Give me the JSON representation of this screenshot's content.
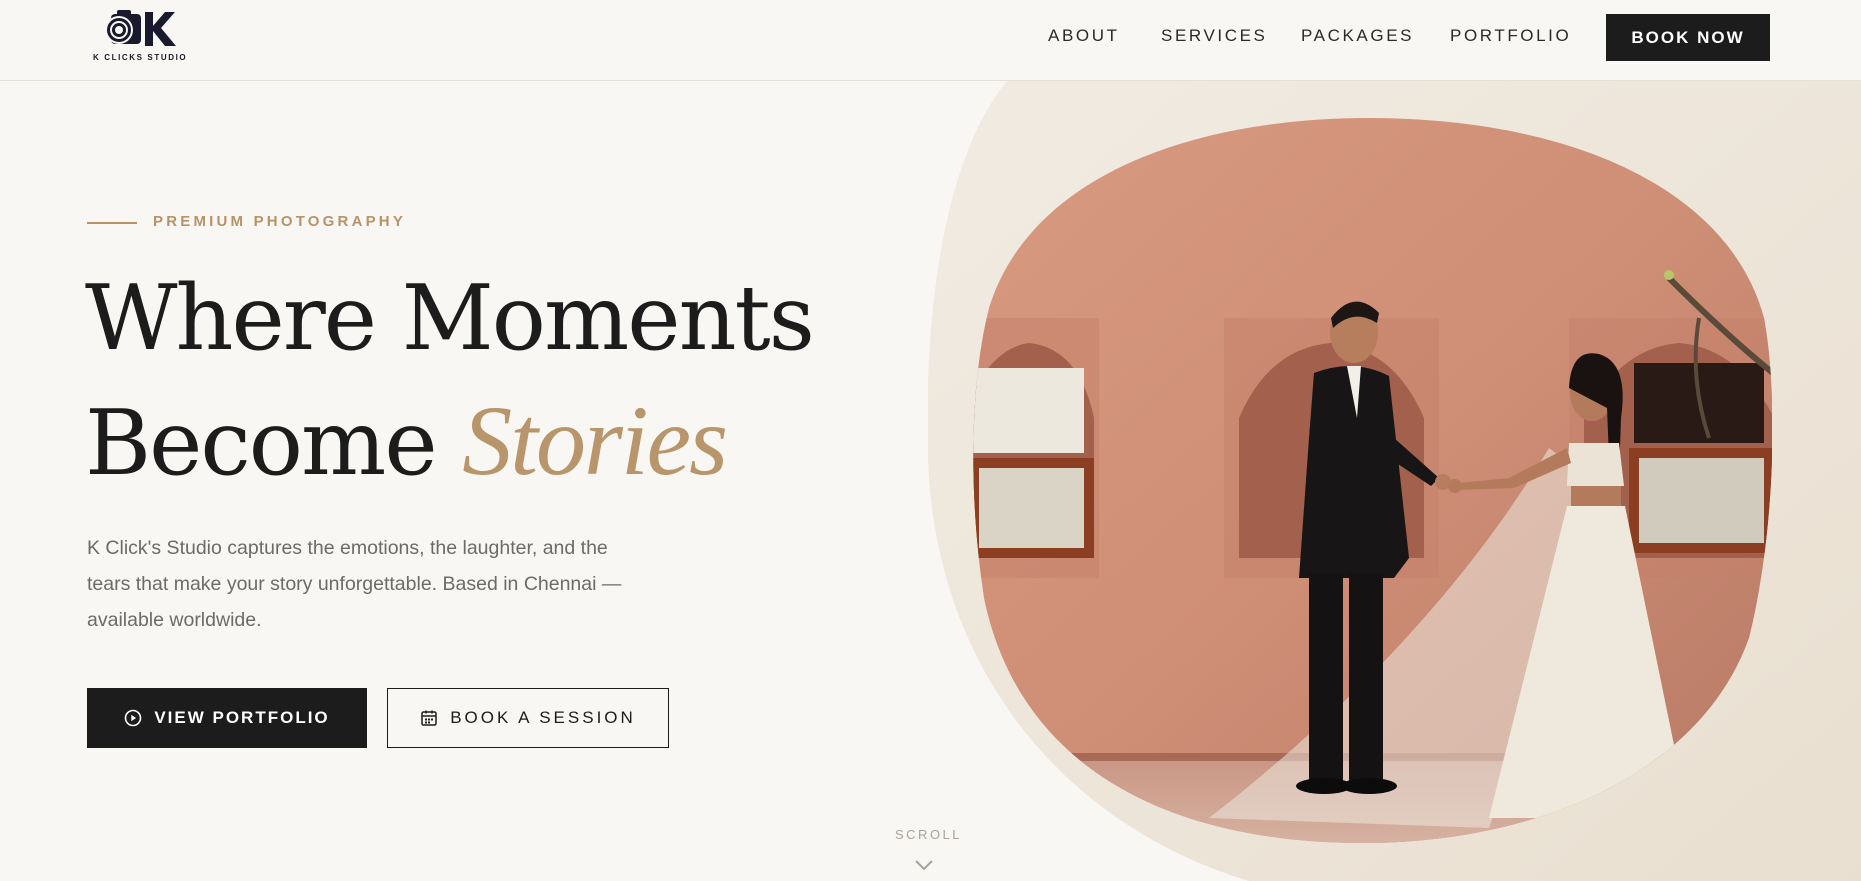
{
  "brand": {
    "logo_text": "K CLICKS STUDIO",
    "logo_color": "#1a1a2e"
  },
  "nav": {
    "items": [
      {
        "label": "ABOUT"
      },
      {
        "label": "SERVICES"
      },
      {
        "label": "PACKAGES"
      },
      {
        "label": "PORTFOLIO"
      }
    ],
    "cta_label": "BOOK NOW"
  },
  "hero": {
    "eyebrow": "PREMIUM PHOTOGRAPHY",
    "headline_line1": "Where Moments",
    "headline_line2_plain": "Become ",
    "headline_line2_accent": "Stories",
    "intro": "K Click's Studio captures the emotions, the laughter, and the tears that make your story unforgettable. Based in Chennai — available worldwide.",
    "primary_button": {
      "label": "VIEW PORTFOLIO",
      "icon": "play-circle-icon"
    },
    "secondary_button": {
      "label": "BOOK A SESSION",
      "icon": "calendar-icon"
    },
    "scroll_label": "SCROLL"
  },
  "colors": {
    "background": "#f9f7f3",
    "accent": "#b8956a",
    "dark": "#1c1c1c",
    "text_muted": "#6b6b6b",
    "blob": "#efe7dc"
  }
}
